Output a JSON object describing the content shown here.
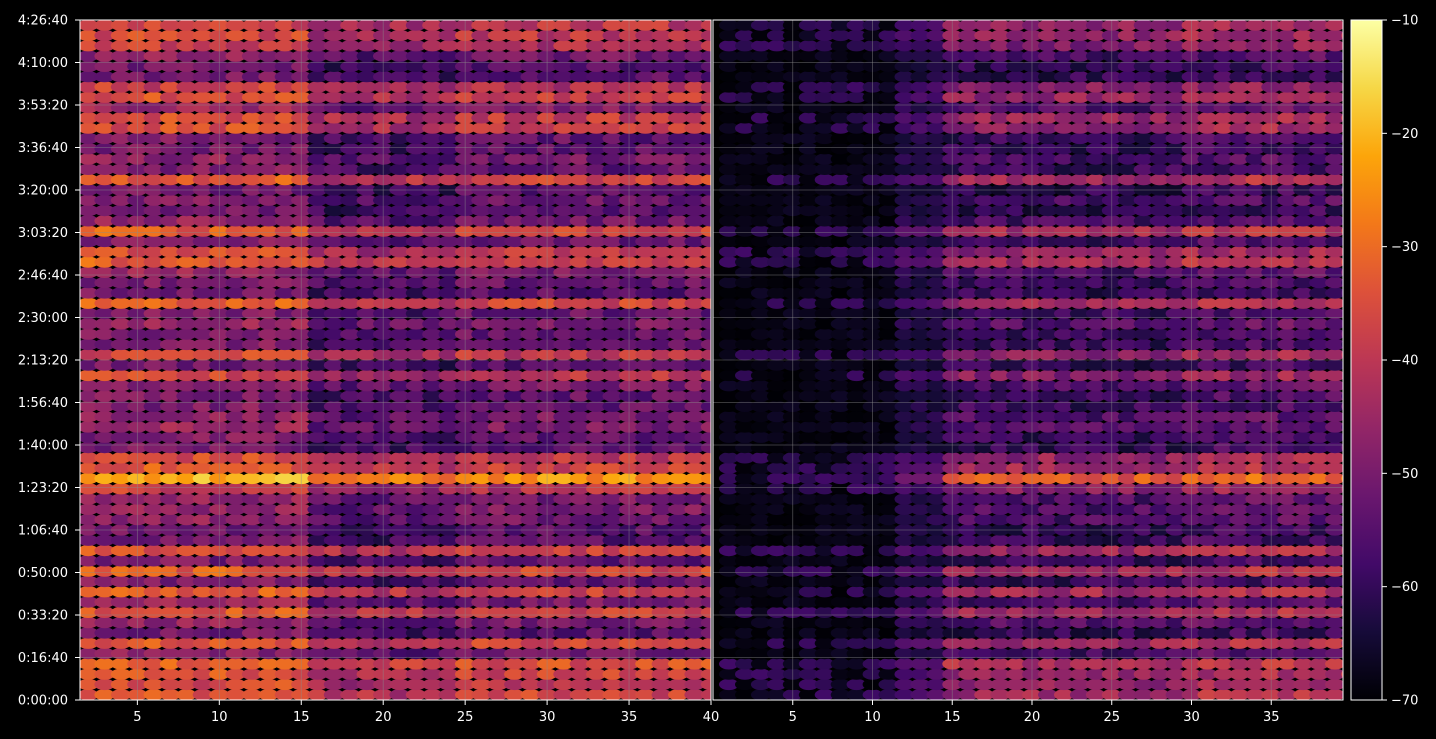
{
  "chart_data": {
    "type": "heatmap",
    "title": "",
    "panels": [
      {
        "name": "",
        "xlim": [
          1.5,
          40
        ]
      },
      {
        "name": "",
        "xlim": [
          0,
          39.5
        ]
      }
    ],
    "x_ticks": [
      5,
      10,
      15,
      20,
      25,
      30,
      35,
      40
    ],
    "x_tick_labels": [
      "5",
      "10",
      "15",
      "20",
      "25",
      "30",
      "35",
      "40"
    ],
    "xlabel": "",
    "ylabel": "",
    "y_unit": "seconds",
    "ylim": [
      0,
      16000
    ],
    "y_ticks": [
      0,
      1000,
      2000,
      3000,
      4000,
      5000,
      6000,
      7000,
      8000,
      9000,
      10000,
      11000,
      12000,
      13000,
      14000,
      15000,
      16000
    ],
    "y_tick_labels": [
      "0:00:00",
      "0:16:40",
      "0:33:20",
      "0:50:00",
      "1:06:40",
      "1:23:20",
      "1:40:00",
      "1:56:40",
      "2:13:20",
      "2:30:00",
      "2:46:40",
      "3:03:20",
      "3:20:00",
      "3:36:40",
      "3:53:20",
      "4:10:00",
      "4:26:40"
    ],
    "colorbar": {
      "colormap": "inferno",
      "range": [
        -70,
        -10
      ],
      "ticks": [
        -70,
        -60,
        -50,
        -40,
        -30,
        -20,
        -10
      ],
      "tick_labels": [
        "−70",
        "−60",
        "−50",
        "−40",
        "−30",
        "−20",
        "−10"
      ]
    },
    "grid": true,
    "background": "#000000",
    "grid_color": "#8c8c8c",
    "strong_bands_time_s": [
      40,
      480,
      870,
      1400,
      2100,
      2550,
      3000,
      3550,
      5100,
      5350,
      5700,
      7600,
      8100,
      9350,
      10450,
      11050,
      12200,
      13550,
      14300,
      15500,
      15900
    ],
    "description_values": "Per-row signal strength in dB on x-bins 1-40 for each panel; left panel stronger (-60 to -15 dB), right panel near -70 dB for x<13 then -60 to -20 dB."
  }
}
